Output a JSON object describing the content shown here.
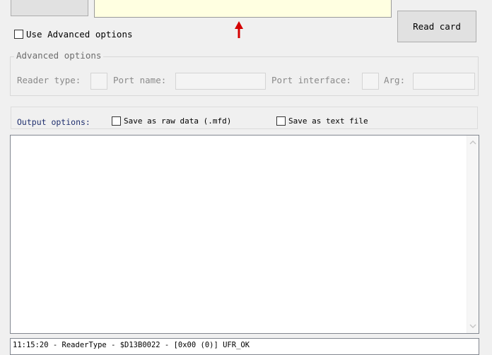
{
  "toolbar": {
    "read_card_label": "Read card"
  },
  "use_advanced_label": "Use Advanced options",
  "advanced": {
    "legend": "Advanced options",
    "reader_type_label": "Reader type:",
    "port_name_label": "Port name:",
    "port_interface_label": "Port interface:",
    "arg_label": "Arg:"
  },
  "output_options": {
    "label": "Output options:",
    "save_raw_label": "Save as raw data (.mfd)",
    "save_text_label": "Save as text file"
  },
  "log": {
    "line": "11:15:20 - ReaderType - $D13B0022 - [0x00 (0)] UFR_OK"
  },
  "colors": {
    "uid_field_bg": "#ffffe1",
    "annotation_arrow": "#d40000",
    "label_blue": "#1f2f6e"
  },
  "icons": {
    "annotation": "red-up-arrow-icon",
    "scroll_up": "scroll-up-icon",
    "scroll_down": "scroll-down-icon"
  }
}
